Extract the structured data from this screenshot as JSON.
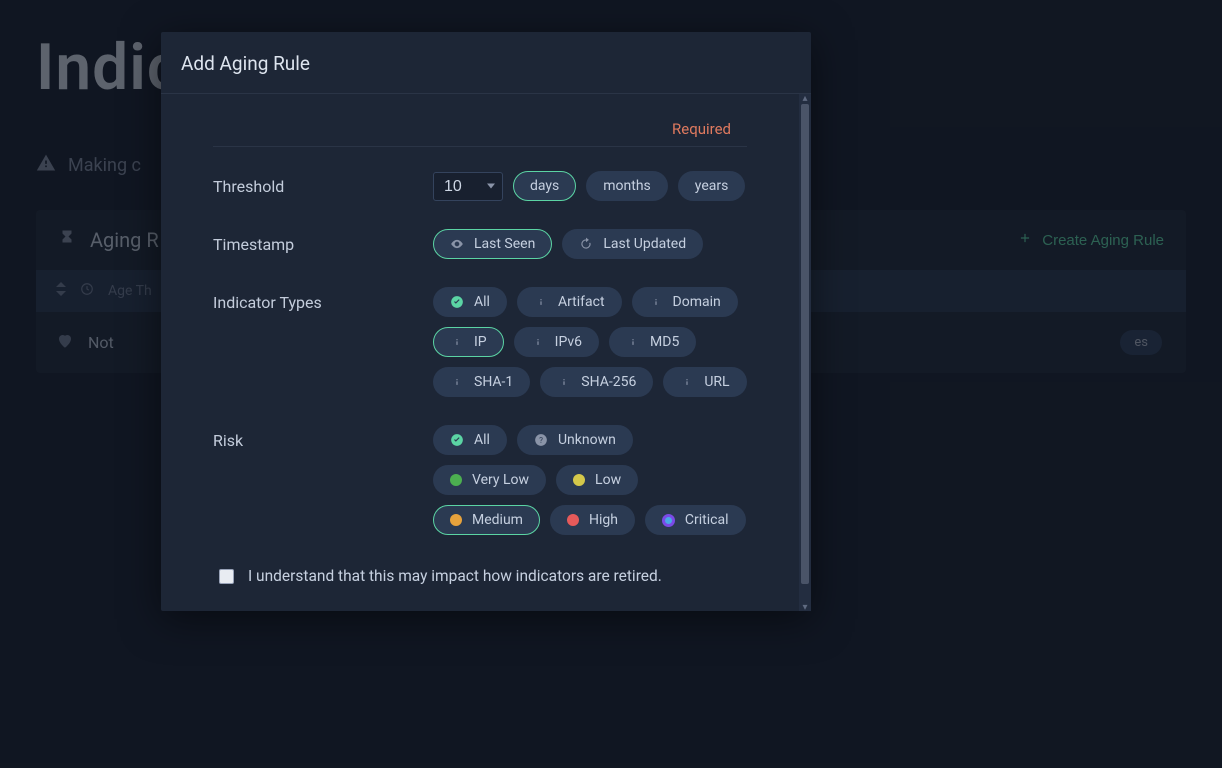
{
  "page": {
    "title_fragment": "Indic",
    "warning_text_fragment": "Making c",
    "panel_title_fragment": "Aging R",
    "create_rule_label": "Create Aging Rule",
    "col_age_threshold": "Age Th",
    "row_status_fragment": "Not",
    "row_pill_fragment": "es"
  },
  "modal": {
    "title": "Add Aging Rule",
    "required_label": "Required",
    "threshold": {
      "label": "Threshold",
      "value": "10",
      "units": {
        "days": "days",
        "months": "months",
        "years": "years"
      },
      "selected_unit": "days"
    },
    "timestamp": {
      "label": "Timestamp",
      "last_seen": "Last Seen",
      "last_updated": "Last Updated",
      "selected": "last_seen"
    },
    "indicator_types": {
      "label": "Indicator Types",
      "options": {
        "all": "All",
        "artifact": "Artifact",
        "domain": "Domain",
        "ip": "IP",
        "ipv6": "IPv6",
        "md5": "MD5",
        "sha1": "SHA-1",
        "sha256": "SHA-256",
        "url": "URL"
      },
      "selected": "ip"
    },
    "risk": {
      "label": "Risk",
      "options": {
        "all": "All",
        "unknown": "Unknown",
        "very_low": "Very Low",
        "low": "Low",
        "medium": "Medium",
        "high": "High",
        "critical": "Critical"
      },
      "selected": "medium"
    },
    "ack_text": "I understand that this may impact how indicators are retired."
  }
}
